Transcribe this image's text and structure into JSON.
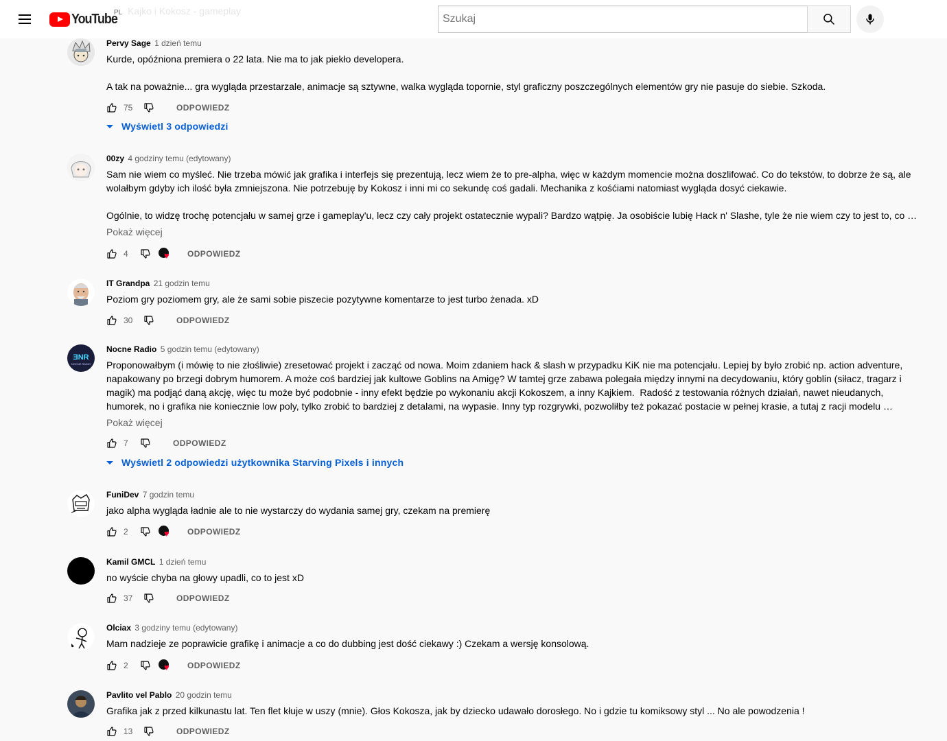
{
  "masthead": {
    "logo_text": "YouTube",
    "country": "PL",
    "ghost_title": "Kajko i Kokosz - gameplay",
    "search_placeholder": "Szukaj"
  },
  "labels": {
    "reply": "ODPOWIEDZ",
    "show_more": "Pokaż więcej"
  },
  "comments": [
    {
      "author": "Pervy Sage",
      "time": "1 dzień temu",
      "text": "Kurde, opóźniona premiera o 22 lata. Nie ma to jak piekło developera.\n\nA tak na poważnie... gra wygląda przestarzale, animacje są sztywne, walka wygląda topornie, styl graficzny poszczególnych elementów gry nie pasuje do siebie. Szkoda.",
      "likes": "75",
      "view_replies": "Wyświetl 3 odpowiedzi"
    },
    {
      "author": "00zy",
      "time": "4 godziny temu (edytowany)",
      "text": "Sam nie wiem co myśleć. Nie trzeba mówić jak grafika i interfejs się prezentują, lecz wiem że to pre-alpha, więc w każdym momencie można doszlifować. Co do tekstów, to dobrze że są, ale wolałbym gdyby ich ilość była zmniejszona. Nie potrzebuję by Kokosz i inni mi co sekundę coś gadali. Mechanika z kośćiami natomiast wygląda dosyć ciekawie.\n\nOgólnie, to widzę trochę potencjału w samej grze i gameplay'u, lecz czy cały projekt ostatecznie wypali? Bardzo wątpię. Ja osobiście lubię Hack n' Slashe, tyle że nie wiem czy to jest to, co fani…",
      "likes": "4"
    },
    {
      "author": "IT Grandpa",
      "time": "21 godzin temu",
      "text": "Poziom gry poziomem gry, ale że sami sobie piszecie pozytywne komentarze to jest turbo żenada. xD",
      "likes": "30"
    },
    {
      "author": "Nocne Radio",
      "time": "5 godzin temu (edytowany)",
      "text": "Proponowałbym (i mówię to nie złośliwie) zresetować projekt i zacząć od nowa. Moim zdaniem hack & slash w przypadku KiK nie ma potencjału. Lepiej by było zrobić np. action adventure, napakowany po brzegi dobrym humorem. A może coś bardziej jak kultowe Goblins na Amigę? W tamtej grze zabawa polegała między innymi na decydowaniu, który goblin (siłacz, tragarz i magik) ma podjąć daną akcję, więc tu może być podobnie - inny efekt będzie po wykonaniu akcji Kokoszem, a inny Kajkiem.  Radość z testowania różnych działań, nawet nieudanych, humorek, no i grafika nie koniecznie low poly, tylko zrobić to bardziej z detalami, na wypasie. Inny typ rozgrywki, pozwoliłby też pokazać postacie w pełnej krasie, a tutaj z racji modelu rozgrywki widzimy…",
      "likes": "7",
      "view_replies": "Wyświetl 2 odpowiedzi użytkownika Starving Pixels i innych"
    },
    {
      "author": "FuniDev",
      "time": "7 godzin temu",
      "text": "jako alpha wygląda ładnie ale to nie wystarczy do wydania samej gry, czekam na premierę",
      "likes": "2"
    },
    {
      "author": "Kamil GMCL",
      "time": "1 dzień temu",
      "text": "no wyście chyba na głowy upadli, co to jest xD",
      "likes": "37"
    },
    {
      "author": "Olciax",
      "time": "3 godziny temu (edytowany)",
      "text": "Mam nadzieje ze poprawicie grafikę i animacje a co do dubbing jest dość ciekawy :) Czekam a wersję konsolową.",
      "likes": "2"
    },
    {
      "author": "Pavlito vel Pablo",
      "time": "20 godzin temu",
      "text": "Grafika jak z przed kilkunastu lat. Ten flet kłuje w uszy (mnie). Głos Kokosza, jak by dziecko udawało dorosłego. No i gdzie tu komiksowy styl ... No ale powodzenia !",
      "likes": "13"
    }
  ]
}
